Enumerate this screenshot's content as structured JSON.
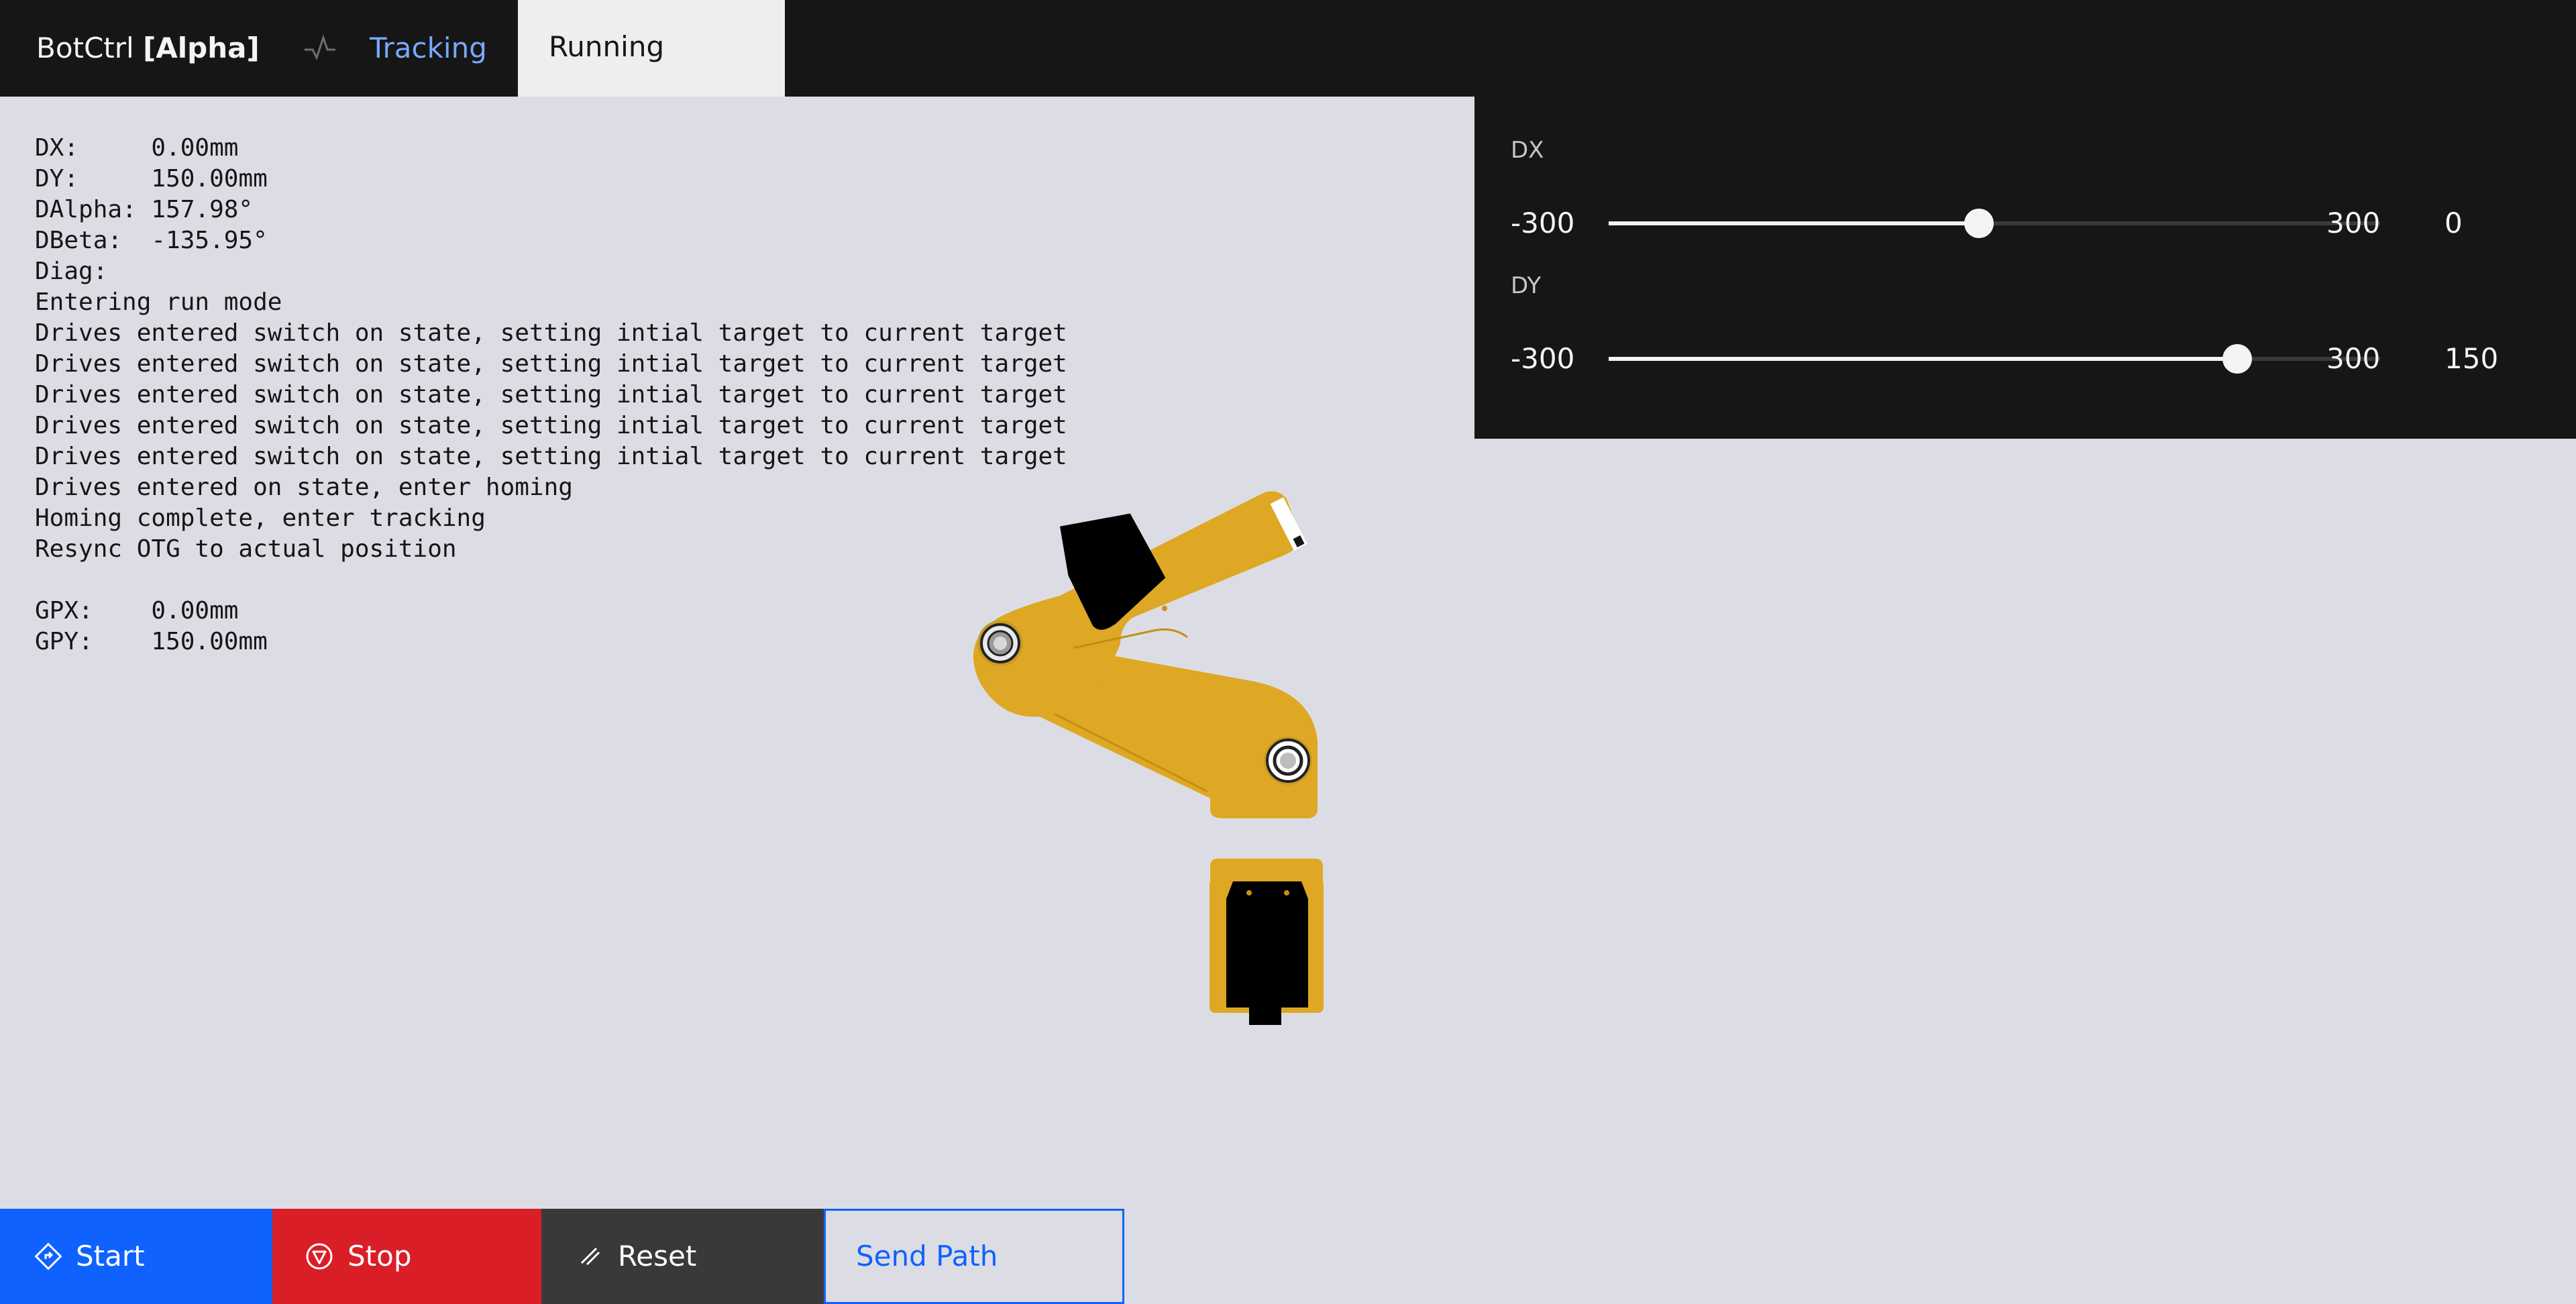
{
  "header": {
    "app_name": "BotCtrl",
    "app_tag": "[Alpha]",
    "status_icon": "pulse-icon",
    "tabs": [
      {
        "label": "Tracking",
        "active": false
      },
      {
        "label": "Running",
        "active": true
      }
    ]
  },
  "console": {
    "lines": [
      "DX:     0.00mm",
      "DY:     150.00mm",
      "DAlpha: 157.98°",
      "DBeta:  -135.95°",
      "Diag: ",
      "Entering run mode",
      "Drives entered switch on state, setting intial target to current target",
      "Drives entered switch on state, setting intial target to current target",
      "Drives entered switch on state, setting intial target to current target",
      "Drives entered switch on state, setting intial target to current target",
      "Drives entered switch on state, setting intial target to current target",
      "Drives entered on state, enter homing",
      "Homing complete, enter tracking",
      "Resync OTG to actual position",
      "",
      "GPX:    0.00mm",
      "GPY:    150.00mm"
    ]
  },
  "sliders": [
    {
      "label": "DX",
      "min": "-300",
      "max": "300",
      "value": "0",
      "position": 0.48
    },
    {
      "label": "DY",
      "min": "-300",
      "max": "300",
      "value": "150",
      "position": 0.815
    }
  ],
  "buttons": {
    "start": {
      "label": "Start",
      "icon": "diamond-arrow-icon"
    },
    "stop": {
      "label": "Stop",
      "icon": "stop-filled-icon"
    },
    "reset": {
      "label": "Reset",
      "icon": "erase-icon"
    },
    "send_path": {
      "label": "Send Path"
    }
  },
  "colors": {
    "header_bg": "#161616",
    "page_bg": "#dcdde4",
    "accent_blue": "#0f62fe",
    "link_blue": "#78a9ff",
    "danger_red": "#da1e28",
    "neutral_dark": "#393939",
    "robot_yellow": "#dea824"
  }
}
